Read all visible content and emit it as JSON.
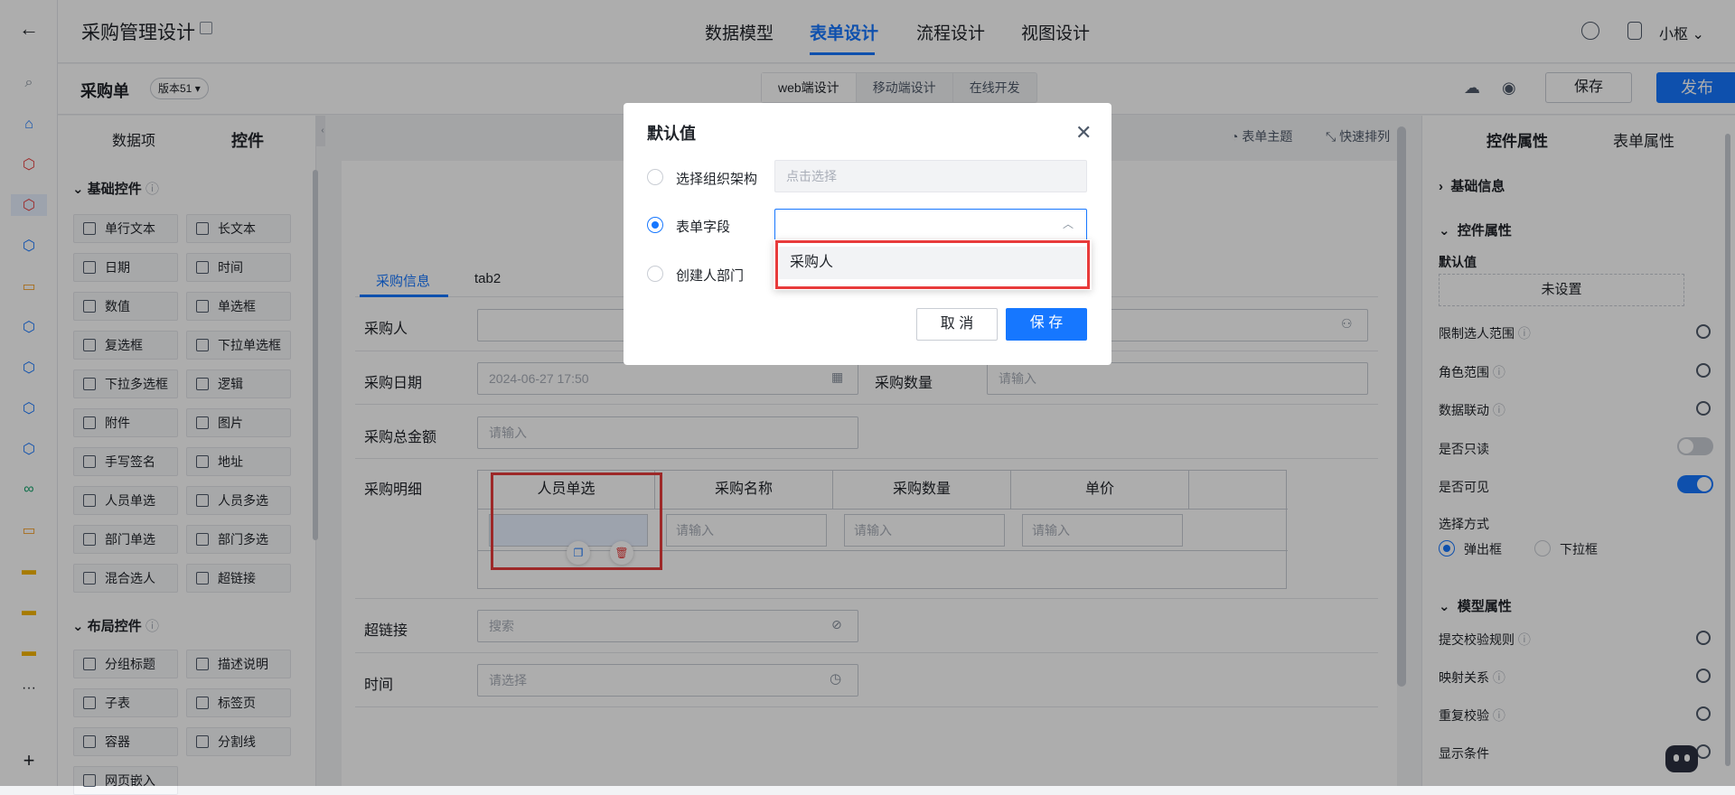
{
  "header": {
    "title": "采购管理设计",
    "nav": [
      "数据模型",
      "表单设计",
      "流程设计",
      "视图设计"
    ],
    "active_nav": "表单设计",
    "user": "小枢"
  },
  "toolbar": {
    "form_name": "采购单",
    "version": "版本51",
    "modes": [
      "web端设计",
      "移动端设计",
      "在线开发"
    ],
    "save_label": "保存",
    "publish_label": "发布"
  },
  "left_panel": {
    "tabs": [
      "数据项",
      "控件"
    ],
    "basic_title": "基础控件",
    "basic": [
      "单行文本",
      "长文本",
      "日期",
      "时间",
      "数值",
      "单选框",
      "复选框",
      "下拉单选框",
      "下拉多选框",
      "逻辑",
      "附件",
      "图片",
      "手写签名",
      "地址",
      "人员单选",
      "人员多选",
      "部门单选",
      "部门多选",
      "混合选人",
      "超链接"
    ],
    "layout_title": "布局控件",
    "layout": [
      "分组标题",
      "描述说明",
      "子表",
      "标签页",
      "容器",
      "分割线",
      "网页嵌入"
    ]
  },
  "canvas": {
    "tools": [
      "表单主题",
      "快速排列"
    ],
    "tabs": [
      "采购信息",
      "tab2"
    ],
    "fields": {
      "buyer": "采购人",
      "date": "采购日期",
      "date_value": "2024-06-27 17:50",
      "qty": "采购数量",
      "qty_ph": "请输入",
      "total": "采购总金额",
      "total_ph": "请输入",
      "detail": "采购明细",
      "link": "超链接",
      "link_ph": "搜索",
      "time": "时间",
      "time_ph": "请选择"
    },
    "table": {
      "headers": [
        "人员单选",
        "采购名称",
        "采购数量",
        "单价"
      ],
      "cell_ph": "请输入"
    }
  },
  "right_panel": {
    "tabs": [
      "控件属性",
      "表单属性"
    ],
    "basic_info": "基础信息",
    "control_props": "控件属性",
    "default_label": "默认值",
    "default_value": "未设置",
    "props": [
      "限制选人范围",
      "角色范围",
      "数据联动"
    ],
    "readonly": "是否只读",
    "visible": "是否可见",
    "select_mode": "选择方式",
    "select_options": [
      "弹出框",
      "下拉框"
    ],
    "model_props": "模型属性",
    "model_items": [
      "提交校验规则",
      "映射关系",
      "重复校验",
      "显示条件"
    ]
  },
  "dialog": {
    "title": "默认值",
    "opt_org": "选择组织架构",
    "org_ph": "点击选择",
    "opt_field": "表单字段",
    "opt_dept": "创建人部门",
    "dropdown_option": "采购人",
    "cancel": "取 消",
    "save": "保 存"
  },
  "colors": {
    "accent": "#1677ff",
    "highlight": "#e83b3b"
  }
}
